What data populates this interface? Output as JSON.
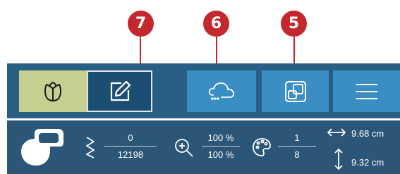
{
  "callouts": [
    "7",
    "6",
    "5"
  ],
  "toolbar": {
    "icons": {
      "embroidery_mode": "tulip-icon",
      "edit_mode": "pencil-edit-icon",
      "cloud": "cloud-icon",
      "resize": "resize-icon",
      "menu": "hamburger-menu-icon"
    },
    "selected_mode": "embroidery_mode"
  },
  "status": {
    "stitches": {
      "current": "0",
      "total": "12198"
    },
    "zoom": {
      "current": "100 %",
      "fit": "100 %"
    },
    "colors": {
      "current": "1",
      "total": "8"
    },
    "width": "9.68 cm",
    "height": "9.32 cm"
  },
  "colors": {
    "toolbar_bg": "#2a5f85",
    "status_bg": "#2b5677",
    "active_segment": "#c6cf8f",
    "button": "#3a8ec4",
    "callout": "#c4272c"
  }
}
